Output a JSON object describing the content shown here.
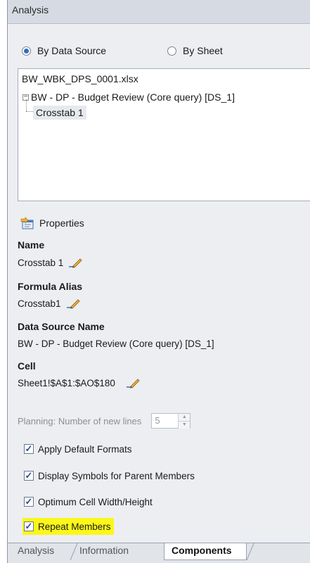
{
  "panel": {
    "title": "Analysis"
  },
  "view_options": {
    "by_data_source": "By Data Source",
    "by_sheet": "By Sheet",
    "selected": "By Data Source"
  },
  "tree": {
    "root": "BW_WBK_DPS_0001.xlsx",
    "query": "BW - DP - Budget Review (Core query) [DS_1]",
    "leaf": "Crosstab 1"
  },
  "properties": {
    "heading": "Properties",
    "name_label": "Name",
    "name_value": "Crosstab 1",
    "alias_label": "Formula Alias",
    "alias_value": "Crosstab1",
    "ds_label": "Data Source Name",
    "ds_value": "BW - DP - Budget Review (Core query) [DS_1]",
    "cell_label": "Cell",
    "cell_value": "Sheet1!$A$1:$AO$180"
  },
  "planning": {
    "label": "Planning: Number of new lines",
    "value": "5"
  },
  "checkboxes": [
    {
      "label": "Apply Default Formats",
      "checked": true
    },
    {
      "label": "Display Symbols for Parent Members",
      "checked": true
    },
    {
      "label": "Optimum Cell Width/Height",
      "checked": true
    },
    {
      "label": "Repeat Members",
      "checked": true,
      "highlighted": true
    }
  ],
  "tabs": [
    {
      "label": "Analysis"
    },
    {
      "label": "Information"
    },
    {
      "label": "Components",
      "active": true
    }
  ],
  "icons": {
    "properties": "properties-icon",
    "edit": "pencil-icon",
    "check": "✓"
  },
  "colors": {
    "highlight": "#fbf71a",
    "panel_bg": "#eceef1"
  }
}
